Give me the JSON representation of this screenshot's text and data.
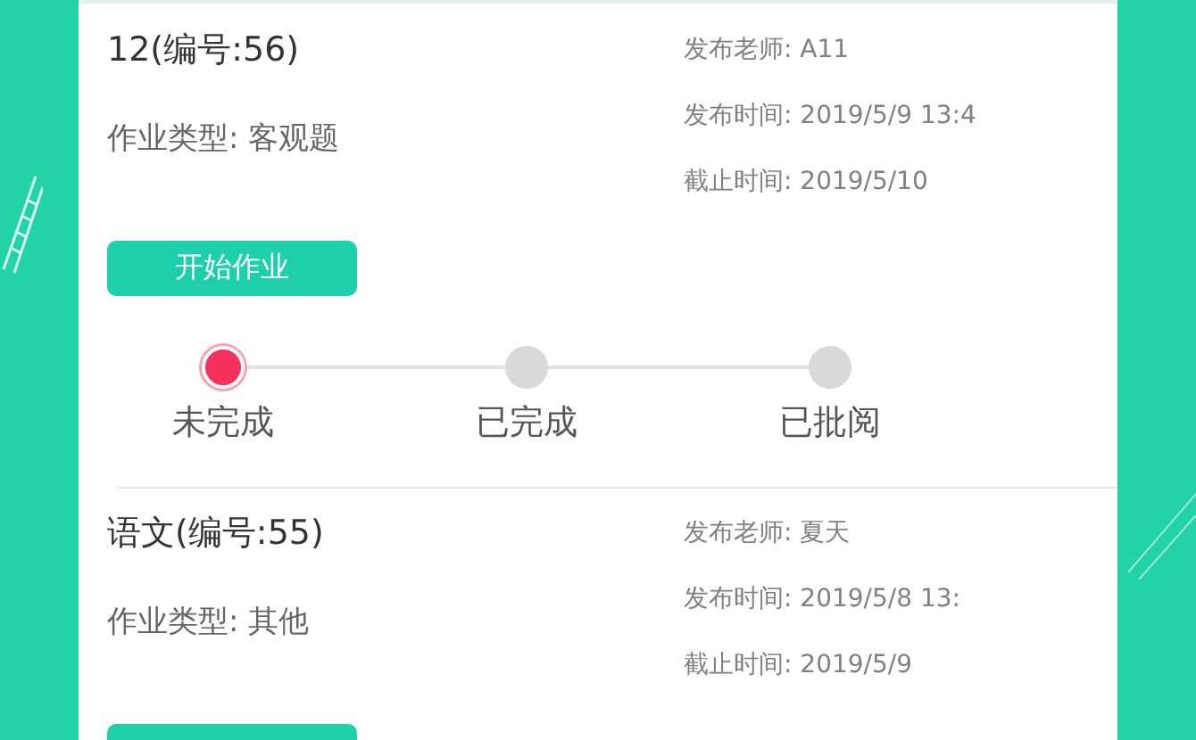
{
  "cards": [
    {
      "title": "12(编号:56)",
      "type_line": "作业类型: 客观题",
      "teacher": "发布老师: A11",
      "publish_time": "发布时间: 2019/5/9 13:4",
      "deadline": "截止时间: 2019/5/10",
      "button": "开始作业",
      "steps": [
        {
          "label": "未完成",
          "active": true
        },
        {
          "label": "已完成",
          "active": false
        },
        {
          "label": "已批阅",
          "active": false
        }
      ]
    },
    {
      "title": "语文(编号:55)",
      "type_line": "作业类型: 其他",
      "teacher": "发布老师: 夏天",
      "publish_time": "发布时间: 2019/5/8 13:",
      "deadline": "截止时间: 2019/5/9"
    }
  ]
}
